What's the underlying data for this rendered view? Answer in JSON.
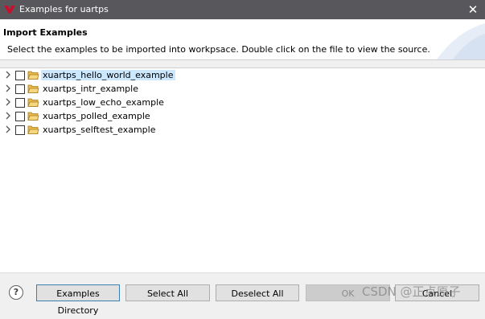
{
  "window": {
    "title": "Examples for uartps"
  },
  "header": {
    "title": "Import Examples",
    "description": "Select the examples to be imported into workpsace. Double click on the file to view the source."
  },
  "examples": [
    {
      "label": "xuartps_hello_world_example",
      "checked": false,
      "selected": true
    },
    {
      "label": "xuartps_intr_example",
      "checked": false,
      "selected": false
    },
    {
      "label": "xuartps_low_echo_example",
      "checked": false,
      "selected": false
    },
    {
      "label": "xuartps_polled_example",
      "checked": false,
      "selected": false
    },
    {
      "label": "xuartps_selftest_example",
      "checked": false,
      "selected": false
    }
  ],
  "buttons": {
    "help": "?",
    "examples_directory": "Examples Directory",
    "select_all": "Select All",
    "deselect_all": "Deselect All",
    "ok": "OK",
    "cancel": "Cancel"
  },
  "watermark": "CSDN @正点原子",
  "colors": {
    "titlebar": "#58585c",
    "selection": "#cce8ff",
    "logo": "#c8102e"
  }
}
